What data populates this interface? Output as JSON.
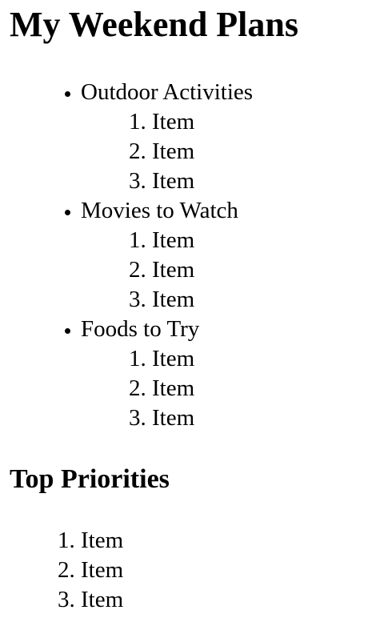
{
  "title": "My Weekend Plans",
  "categories": [
    {
      "label": "Outdoor Activities",
      "items": [
        "Item",
        "Item",
        "Item"
      ]
    },
    {
      "label": "Movies to Watch",
      "items": [
        "Item",
        "Item",
        "Item"
      ]
    },
    {
      "label": "Foods to Try",
      "items": [
        "Item",
        "Item",
        "Item"
      ]
    }
  ],
  "priorities": {
    "heading": "Top Priorities",
    "items": [
      "Item",
      "Item",
      "Item"
    ]
  }
}
